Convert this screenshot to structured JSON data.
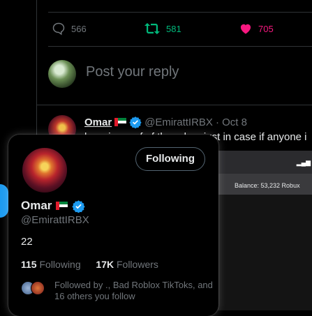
{
  "actions": {
    "reply_count": "566",
    "retweet_count": "581",
    "like_count": "705",
    "reply_color": "#71767b",
    "retweet_color": "#00ba7c",
    "like_color": "#f91880"
  },
  "composer": {
    "placeholder": "Post your reply"
  },
  "tweet": {
    "author_name": "Omar",
    "author_handle": "@EmirattIRBX",
    "date": "· Oct 8",
    "text": "here is proof of the robux just in case if anyone i",
    "image": {
      "balance_text": "Balance: 53,232 Robux"
    }
  },
  "hover_card": {
    "follow_button_label": "Following",
    "name": "Omar",
    "handle": "@EmirattIRBX",
    "bio": "22",
    "following_count": "115",
    "following_label": "Following",
    "followers_count": "17K",
    "followers_label": "Followers",
    "followed_by_text": "Followed by ., Bad Roblox TikToks, and 16 others you follow"
  },
  "colors": {
    "accent": "#1d9bf0",
    "background": "#000000",
    "muted_text": "#71767b"
  }
}
